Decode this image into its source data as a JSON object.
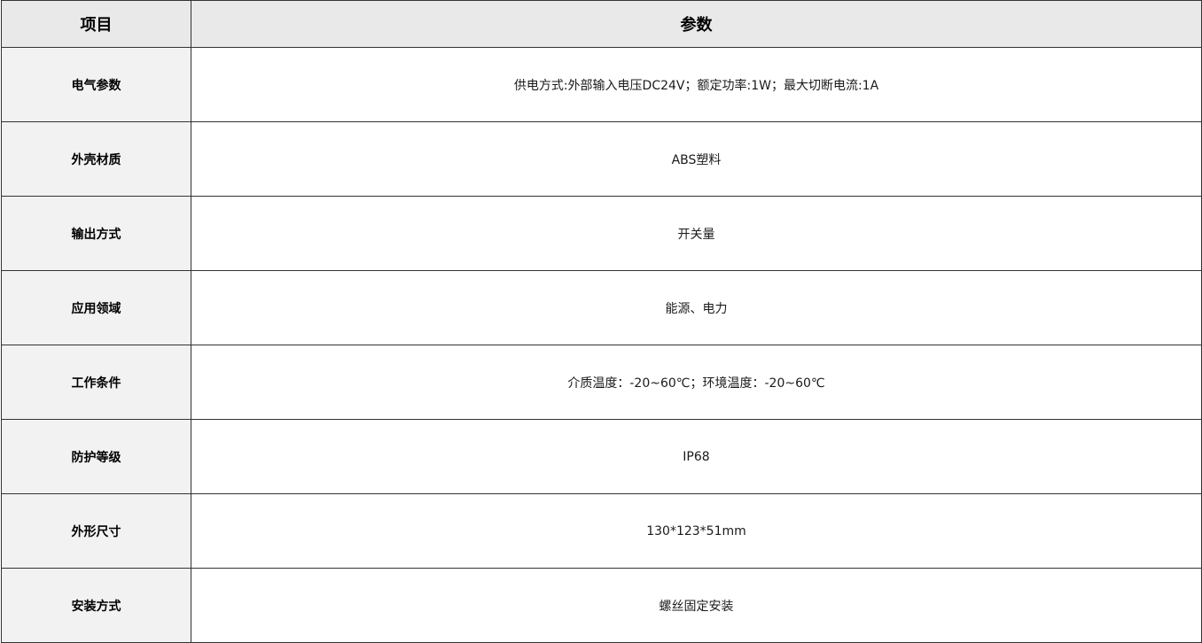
{
  "table": {
    "headers": {
      "item": "项目",
      "value": "参数"
    },
    "rows": [
      {
        "item": "电气参数",
        "value": "供电方式:外部输入电压DC24V；额定功率:1W；最大切断电流:1A"
      },
      {
        "item": "外壳材质",
        "value": "ABS塑料"
      },
      {
        "item": "输出方式",
        "value": "开关量"
      },
      {
        "item": "应用领域",
        "value": "能源、电力"
      },
      {
        "item": "工作条件",
        "value": "介质温度：-20~60℃；环境温度：-20~60℃"
      },
      {
        "item": "防护等级",
        "value": "IP68"
      },
      {
        "item": "外形尺寸",
        "value": "130*123*51mm"
      },
      {
        "item": "安装方式",
        "value": "螺丝固定安装"
      }
    ]
  }
}
